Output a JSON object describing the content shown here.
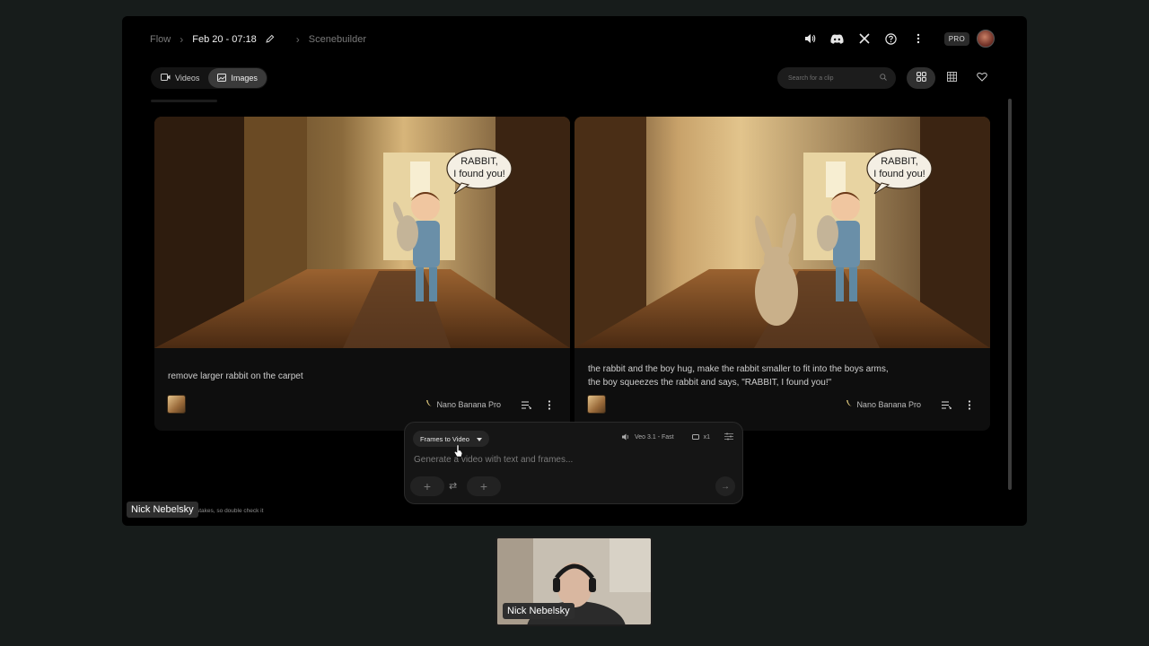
{
  "breadcrumb": {
    "root": "Flow",
    "project": "Feb 20 - 07:18",
    "page": "Scenebuilder"
  },
  "header": {
    "plan_badge": "PRO",
    "icons": [
      "volume-icon",
      "discord-icon",
      "x-icon",
      "help-icon",
      "more-vert-icon"
    ]
  },
  "tabs": [
    {
      "label": "Videos",
      "icon": "video-icon",
      "active": false
    },
    {
      "label": "Images",
      "icon": "image-icon",
      "active": true
    }
  ],
  "search": {
    "placeholder": "Search for a clip"
  },
  "cards": [
    {
      "prompt_lines": [
        "remove larger rabbit on the carpet"
      ],
      "speech_bubble": [
        "RABBIT,",
        "I found you!"
      ],
      "model": "Nano Banana Pro"
    },
    {
      "prompt_lines": [
        "the rabbit and the boy hug, make the rabbit smaller to fit into the boys arms,",
        "the boy squeezes the rabbit and says, \"RABBIT, I found you!\""
      ],
      "speech_bubble": [
        "RABBIT,",
        "I found you!"
      ],
      "model": "Nano Banana Pro"
    }
  ],
  "composer": {
    "mode": "Frames to Video",
    "model": "Veo 3.1 - Fast",
    "count": "x1",
    "placeholder": "Generate a video with text and frames..."
  },
  "disclaimer": "stakes, so double check it",
  "presenter": {
    "name_app": "Nick Nebelsky",
    "name_cam": "Nick Nebelsky"
  },
  "colors": {
    "page_bg": "#171c1b",
    "app_bg": "#000000",
    "card_bg": "#0e0e0e",
    "active_tab": "#3a3a3a"
  }
}
